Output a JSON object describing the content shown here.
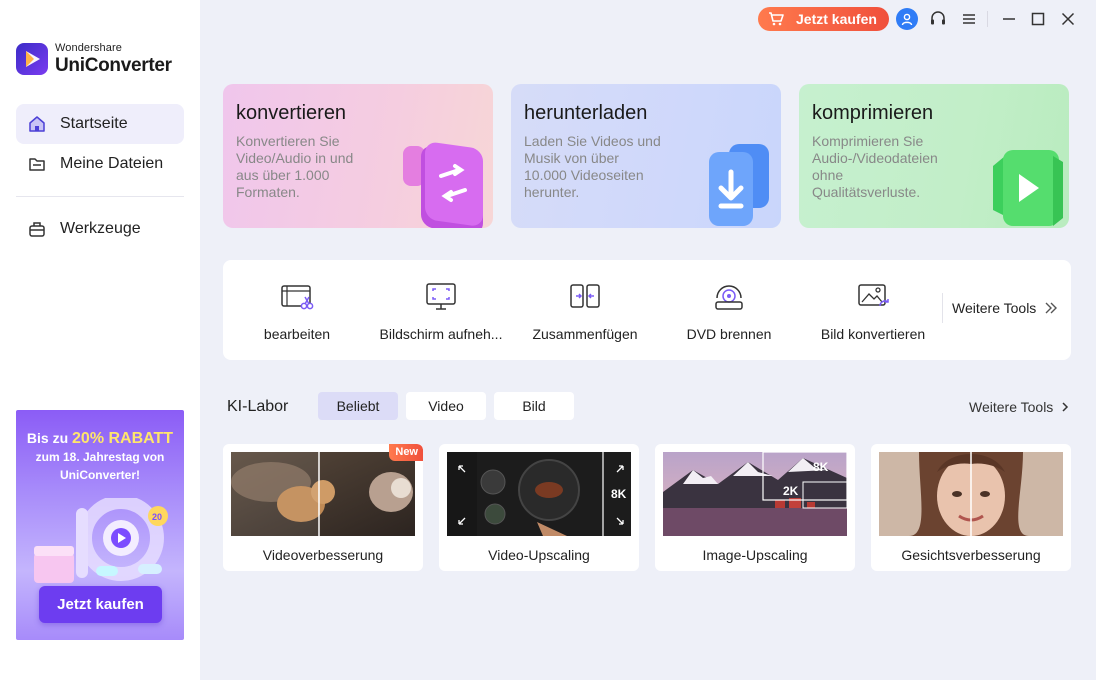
{
  "app": {
    "brand": "Wondershare",
    "product": "UniConverter"
  },
  "titlebar": {
    "buy_label": "Jetzt kaufen",
    "icons": [
      "cart-icon",
      "user-icon",
      "headset-icon",
      "menu-icon",
      "minimize-icon",
      "maximize-icon",
      "close-icon"
    ]
  },
  "sidebar": {
    "items": [
      {
        "label": "Startseite",
        "icon": "home-icon",
        "active": true
      },
      {
        "label": "Meine Dateien",
        "icon": "folder-icon",
        "active": false
      },
      {
        "label": "Werkzeuge",
        "icon": "toolbox-icon",
        "active": false
      }
    ],
    "promo": {
      "line1_pre": "Bis zu ",
      "line1_hl": "20% RABATT",
      "line2": "zum 18. Jahrestag von",
      "line3": "UniConverter!",
      "button": "Jetzt kaufen"
    }
  },
  "cards": [
    {
      "title": "konvertieren",
      "desc": "Konvertieren Sie Video/Audio in und aus über 1.000 Formaten."
    },
    {
      "title": "herunterladen",
      "desc": "Laden Sie Videos und Musik von über 10.000 Videoseiten herunter."
    },
    {
      "title": "komprimieren",
      "desc": "Komprimieren Sie Audio-/Videodateien ohne Qualitätsverluste."
    }
  ],
  "tools": {
    "items": [
      {
        "label": "bearbeiten",
        "icon": "edit-video-icon"
      },
      {
        "label": "Bildschirm aufneh...",
        "icon": "screen-record-icon"
      },
      {
        "label": "Zusammenfügen",
        "icon": "merge-icon"
      },
      {
        "label": "DVD brennen",
        "icon": "dvd-burn-icon"
      },
      {
        "label": "Bild konvertieren",
        "icon": "image-convert-icon"
      }
    ],
    "more_label": "Weitere Tools"
  },
  "ai_lab": {
    "title": "KI-Labor",
    "tabs": [
      {
        "label": "Beliebt",
        "active": true
      },
      {
        "label": "Video",
        "active": false
      },
      {
        "label": "Bild",
        "active": false
      }
    ],
    "more_label": "Weitere Tools",
    "cards": [
      {
        "label": "Videoverbesserung",
        "badge": "New"
      },
      {
        "label": "Video-Upscaling",
        "overlay": "8K"
      },
      {
        "label": "Image-Upscaling",
        "overlay_a": "8K",
        "overlay_b": "2K"
      },
      {
        "label": "Gesichtsverbesserung"
      }
    ]
  },
  "colors": {
    "accent": "#6d3df0",
    "buy": "#f0503c",
    "background": "#eef0f8"
  }
}
